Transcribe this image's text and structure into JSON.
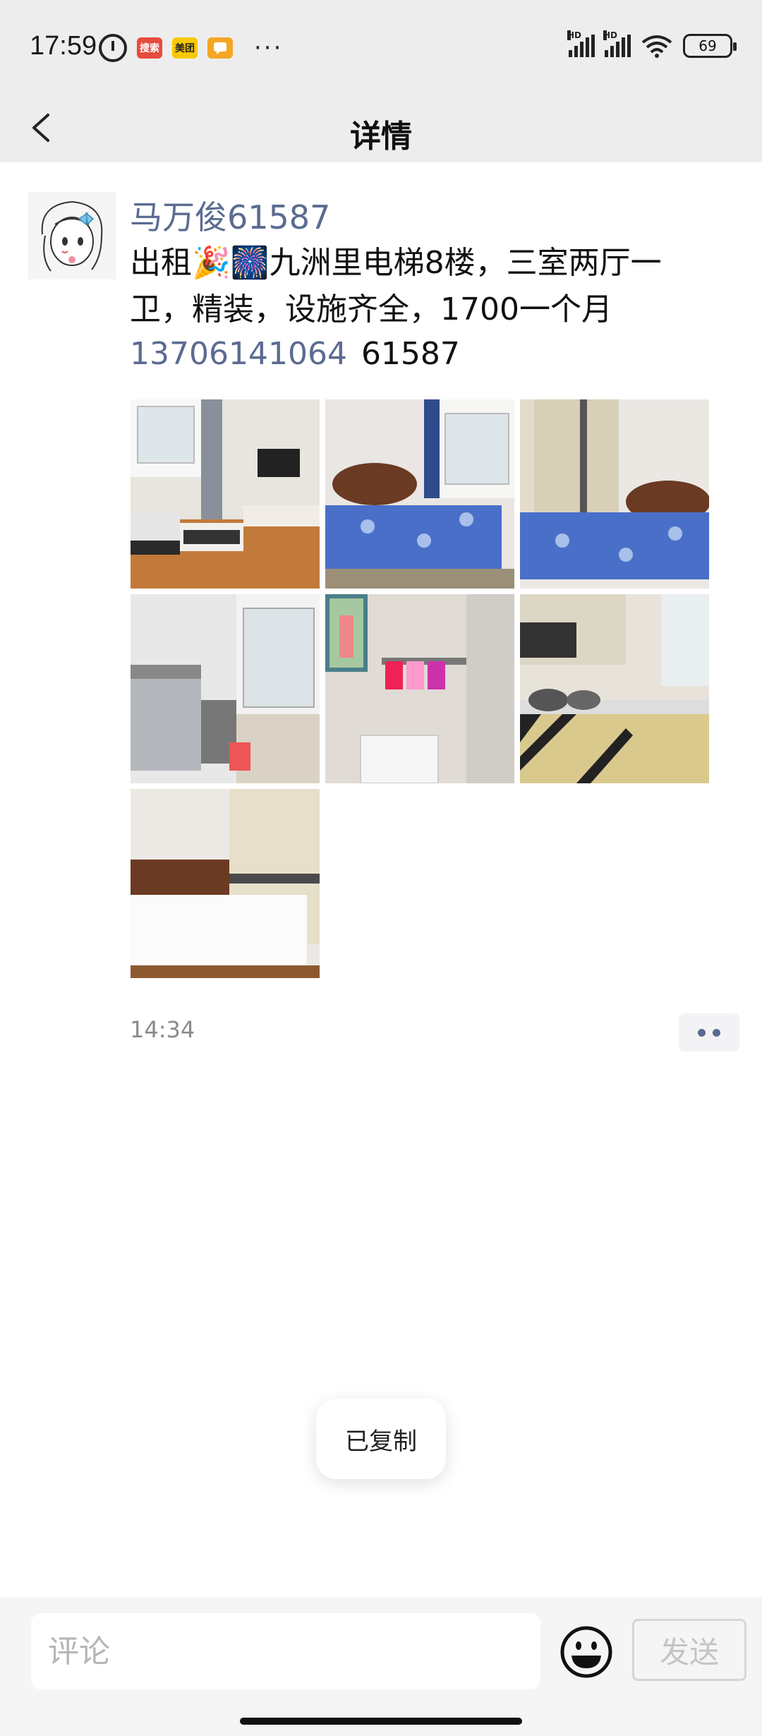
{
  "status_bar": {
    "time": "17:59",
    "apps": [
      "搜索",
      "美团",
      ""
    ],
    "more": "···",
    "signal_labels": [
      "HD",
      "HD"
    ],
    "battery": "69"
  },
  "nav": {
    "title": "详情"
  },
  "post": {
    "username": "马万俊61587",
    "text": "出租🎉🎆九洲里电梯8楼，三室两厅一卫，精装，设施齐全，1700一个月",
    "phone": "13706141064",
    "phone_suffix": "61587",
    "time": "14:34",
    "images": [
      {
        "name": "living-room-photo"
      },
      {
        "name": "bedroom-blue-photo"
      },
      {
        "name": "bedroom-wardrobe-photo"
      },
      {
        "name": "laundry-photo"
      },
      {
        "name": "bathroom-photo"
      },
      {
        "name": "kitchen-photo"
      },
      {
        "name": "bedroom-white-photo"
      }
    ]
  },
  "toast": {
    "text": "已复制"
  },
  "comment": {
    "placeholder": "评论",
    "send_label": "发送"
  },
  "colors": {
    "link": "#5b6b91",
    "top_bg": "#ededed",
    "bar_bg": "#f5f5f5"
  }
}
